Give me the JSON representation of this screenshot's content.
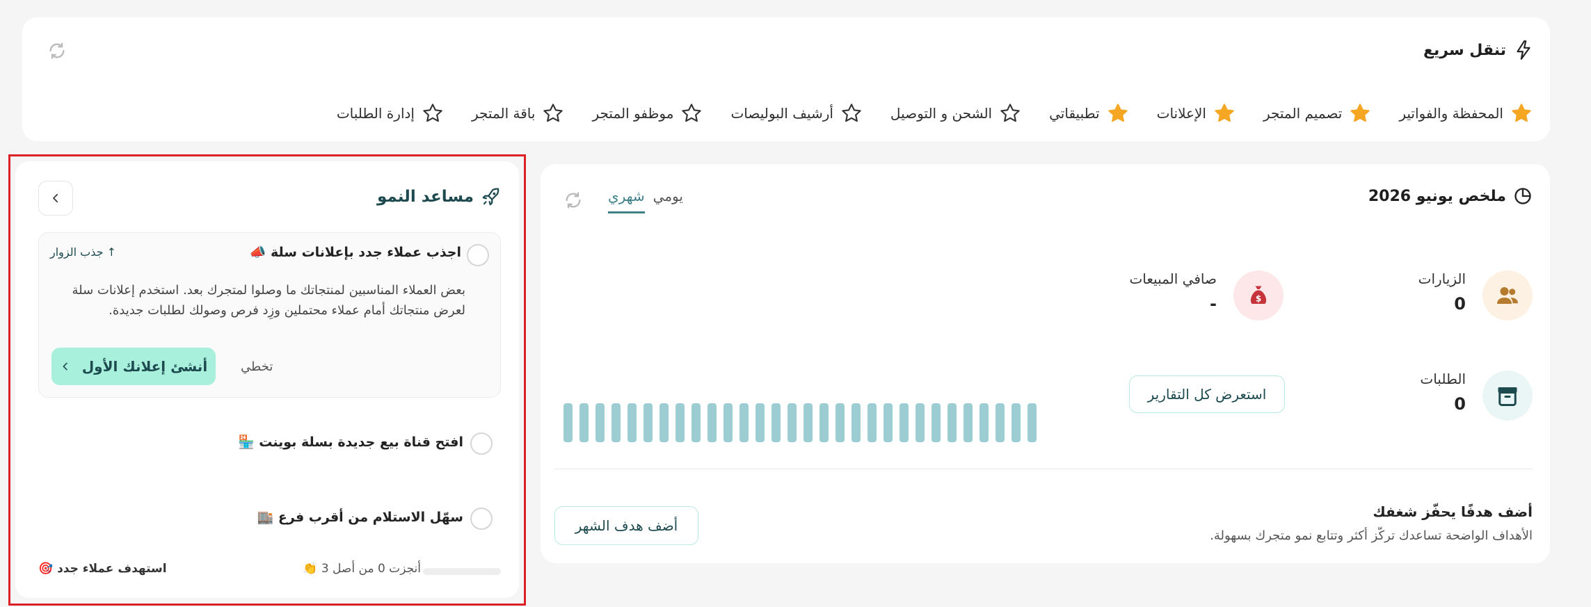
{
  "quick_nav": {
    "title": "تنقل سريع",
    "items": [
      {
        "label": "المحفظة والفواتير",
        "starred": true
      },
      {
        "label": "تصميم المتجر",
        "starred": true
      },
      {
        "label": "الإعلانات",
        "starred": true
      },
      {
        "label": "تطبيقاتي",
        "starred": true
      },
      {
        "label": "الشحن و التوصيل",
        "starred": false
      },
      {
        "label": "أرشيف البوليصات",
        "starred": false
      },
      {
        "label": "موظفو المتجر",
        "starred": false
      },
      {
        "label": "باقة المتجر",
        "starred": false
      },
      {
        "label": "إدارة الطلبات",
        "starred": false
      }
    ]
  },
  "summary": {
    "title": "ملخص يونيو 2026",
    "tabs": [
      {
        "label": "يومي",
        "active": false
      },
      {
        "label": "شهري",
        "active": true
      }
    ],
    "stats": {
      "visits": {
        "label": "الزيارات",
        "value": "0"
      },
      "net_sales": {
        "label": "صافي المبيعات",
        "value": "-"
      },
      "orders": {
        "label": "الطلبات",
        "value": "0"
      }
    },
    "reports_button": "استعرض كل التقارير",
    "goal": {
      "title": "أضف هدفًا يحفّز شغفك",
      "description": "الأهداف الواضحة تساعدك تركّز أكثر وتتابع نمو متجرك بسهولة.",
      "button": "أضف هدف الشهر"
    }
  },
  "growth": {
    "title": "مساعد النمو",
    "tasks": [
      {
        "title": "اجذب عملاء جدد بإعلانات سلة 📣",
        "tag": "جذب الزوار",
        "description": "بعض العملاء المناسبين لمنتجاتك ما وصلوا لمتجرك بعد. استخدم إعلانات سلة لعرض منتجاتك أمام عملاء محتملين وزِد فرص وصولك لطلبات جديدة.",
        "primary_button": "أنشئ إعلانك الأول",
        "skip": "تخطي"
      },
      {
        "title": "افتح قناة بيع جديدة بسلة بوينت 🏪"
      },
      {
        "title": "سهّل الاستلام من أقرب فرع 🏬"
      }
    ],
    "progress": {
      "label": "أنجزت 0 من أصل 3 👏",
      "completed": 0,
      "total": 3
    },
    "target_label": "استهدف عملاء جدد 🎯"
  },
  "colors": {
    "accent": "#3e7f88",
    "star_active": "#f5a623",
    "bar": "#9ccdd3",
    "primary_button": "#a8f0dc",
    "highlight_frame": "#dd1f26"
  },
  "bar_chart": {
    "bar_count": 30
  }
}
